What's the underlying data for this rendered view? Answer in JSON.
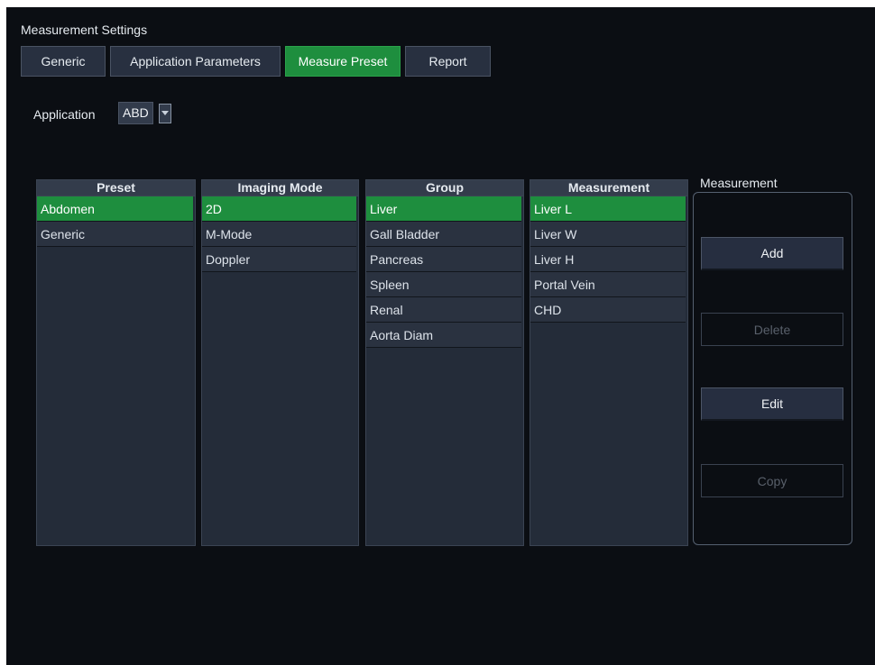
{
  "window": {
    "title": "Measurement Settings"
  },
  "tabs": [
    {
      "label": "Generic",
      "active": false
    },
    {
      "label": "Application Parameters",
      "active": false
    },
    {
      "label": "Measure Preset",
      "active": true
    },
    {
      "label": "Report",
      "active": false
    }
  ],
  "application": {
    "label": "Application",
    "value": "ABD",
    "icon": "dropdown-arrow-icon"
  },
  "columns": {
    "preset": {
      "header": "Preset",
      "items": [
        "Abdomen",
        "Generic"
      ],
      "selected": "Abdomen"
    },
    "imaging_mode": {
      "header": "Imaging Mode",
      "items": [
        "2D",
        "M-Mode",
        "Doppler"
      ],
      "selected": "2D"
    },
    "group": {
      "header": "Group",
      "items": [
        "Liver",
        "Gall Bladder",
        "Pancreas",
        "Spleen",
        "Renal",
        "Aorta Diam"
      ],
      "selected": "Liver"
    },
    "measurement": {
      "header": "Measurement",
      "items": [
        "Liver L",
        "Liver W",
        "Liver H",
        "Portal Vein",
        "CHD"
      ],
      "selected": "Liver L"
    }
  },
  "measurement_panel": {
    "legend": "Measurement",
    "buttons": [
      {
        "label": "Add",
        "enabled": true
      },
      {
        "label": "Delete",
        "enabled": false
      },
      {
        "label": "Edit",
        "enabled": true
      },
      {
        "label": "Copy",
        "enabled": false
      }
    ]
  },
  "colors": {
    "accent": "#1e8e3e",
    "background": "#0b0e13",
    "list_bg": "#242c39"
  }
}
